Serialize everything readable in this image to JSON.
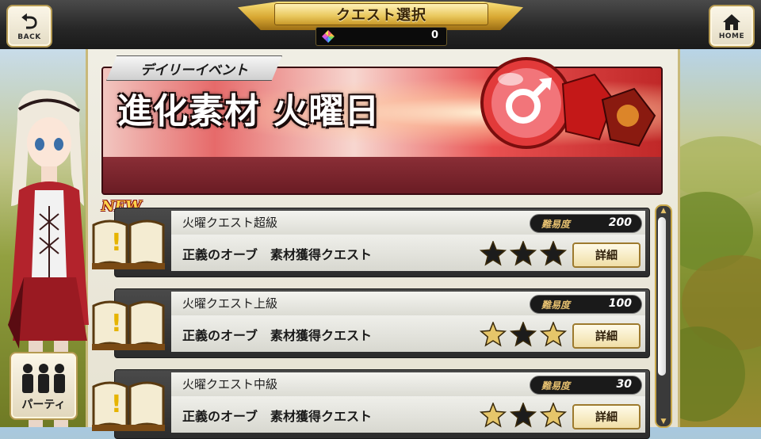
{
  "header": {
    "title": "クエスト選択",
    "back_label": "BACK",
    "home_label": "HOME",
    "gem_count": "0"
  },
  "event": {
    "tag": "デイリーイベント",
    "title": "進化素材 火曜日"
  },
  "quests": [
    {
      "is_new": true,
      "new_label": "NEW",
      "name": "火曜クエスト超級",
      "description": "正義のオーブ　素材獲得クエスト",
      "difficulty_label": "難易度",
      "difficulty": "200",
      "stars": [
        "dark",
        "dark",
        "dark"
      ],
      "detail_label": "詳細"
    },
    {
      "is_new": false,
      "name": "火曜クエスト上級",
      "description": "正義のオーブ　素材獲得クエスト",
      "difficulty_label": "難易度",
      "difficulty": "100",
      "stars": [
        "gold",
        "dark",
        "gold"
      ],
      "detail_label": "詳細"
    },
    {
      "is_new": false,
      "name": "火曜クエスト中級",
      "description": "正義のオーブ　素材獲得クエスト",
      "difficulty_label": "難易度",
      "difficulty": "30",
      "stars": [
        "gold",
        "dark",
        "gold"
      ],
      "detail_label": "詳細"
    }
  ],
  "party": {
    "label": "パーティ"
  },
  "colors": {
    "star_dark": "#1c1c1c",
    "star_gold": "#e6c66a",
    "banner_red": "#c02828",
    "frame_gold": "#c9a84a"
  },
  "icons": {
    "back": "return-arrow-icon",
    "home": "house-icon",
    "gem": "rainbow-gem-icon",
    "quest": "open-book-icon",
    "party": "party-members-icon"
  }
}
